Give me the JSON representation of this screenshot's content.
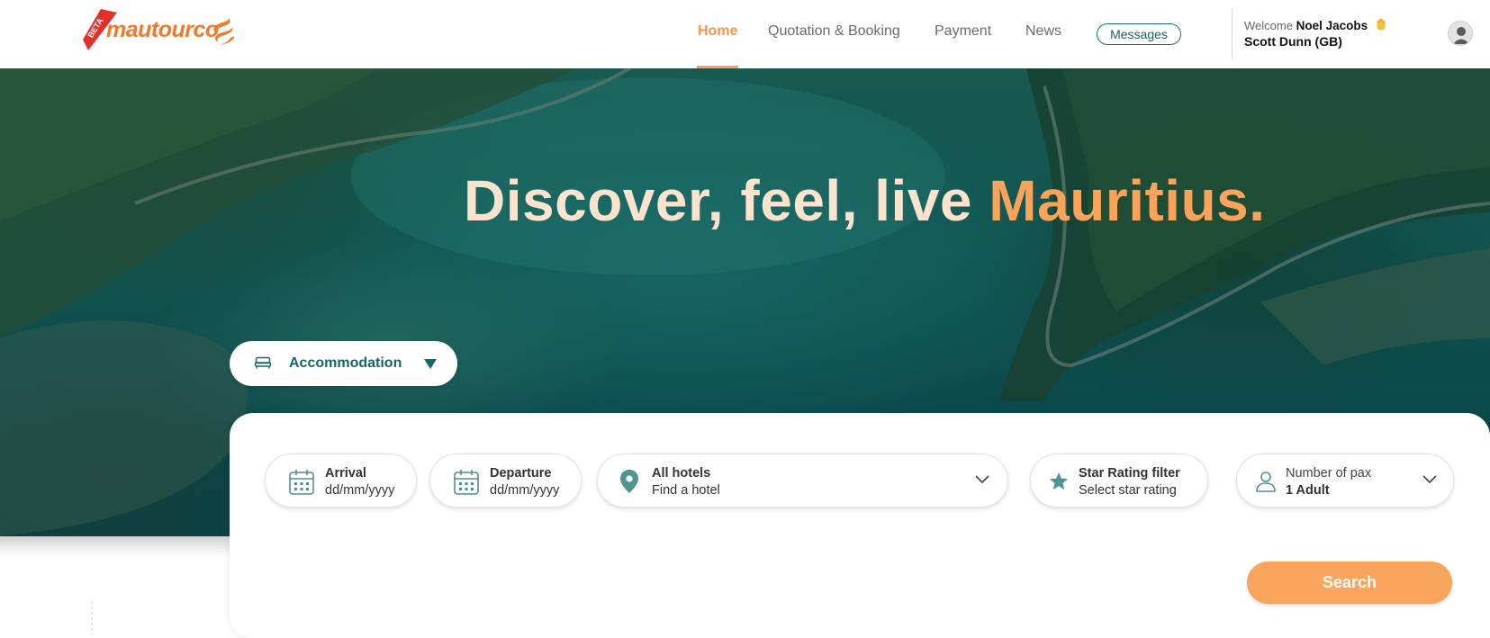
{
  "header": {
    "logo": {
      "beta": "BETA",
      "text": "mautourco"
    },
    "nav": [
      {
        "label": "Home",
        "active": true
      },
      {
        "label": "Quotation & Booking",
        "active": false
      },
      {
        "label": "Payment",
        "active": false
      },
      {
        "label": "News",
        "active": false
      }
    ],
    "messages_label": "Messages",
    "user": {
      "welcome_prefix": "Welcome",
      "name": "Noel Jacobs",
      "company": "Scott Dunn (GB)"
    },
    "icons": {
      "wave": "waving-hand-icon",
      "avatar": "user-avatar-icon"
    }
  },
  "hero": {
    "title_main": "Discover, feel, live",
    "title_accent": "Mauritius."
  },
  "service_selector": {
    "label": "Accommodation",
    "icon": "bed-icon"
  },
  "search": {
    "arrival": {
      "label": "Arrival",
      "value": "dd/mm/yyyy",
      "icon": "calendar-icon"
    },
    "departure": {
      "label": "Departure",
      "value": "dd/mm/yyyy",
      "icon": "calendar-icon"
    },
    "hotel": {
      "label": "All hotels",
      "value": "Find a hotel",
      "icon": "map-pin-icon"
    },
    "star": {
      "label": "Star Rating filter",
      "value": "Select star rating",
      "icon": "star-icon"
    },
    "pax": {
      "label": "Number of pax",
      "value": "1 Adult",
      "icon": "person-icon"
    },
    "button_label": "Search"
  },
  "colors": {
    "accent_orange": "#f9a55d",
    "teal": "#14666a",
    "hero_title": "#fbe3cd"
  }
}
